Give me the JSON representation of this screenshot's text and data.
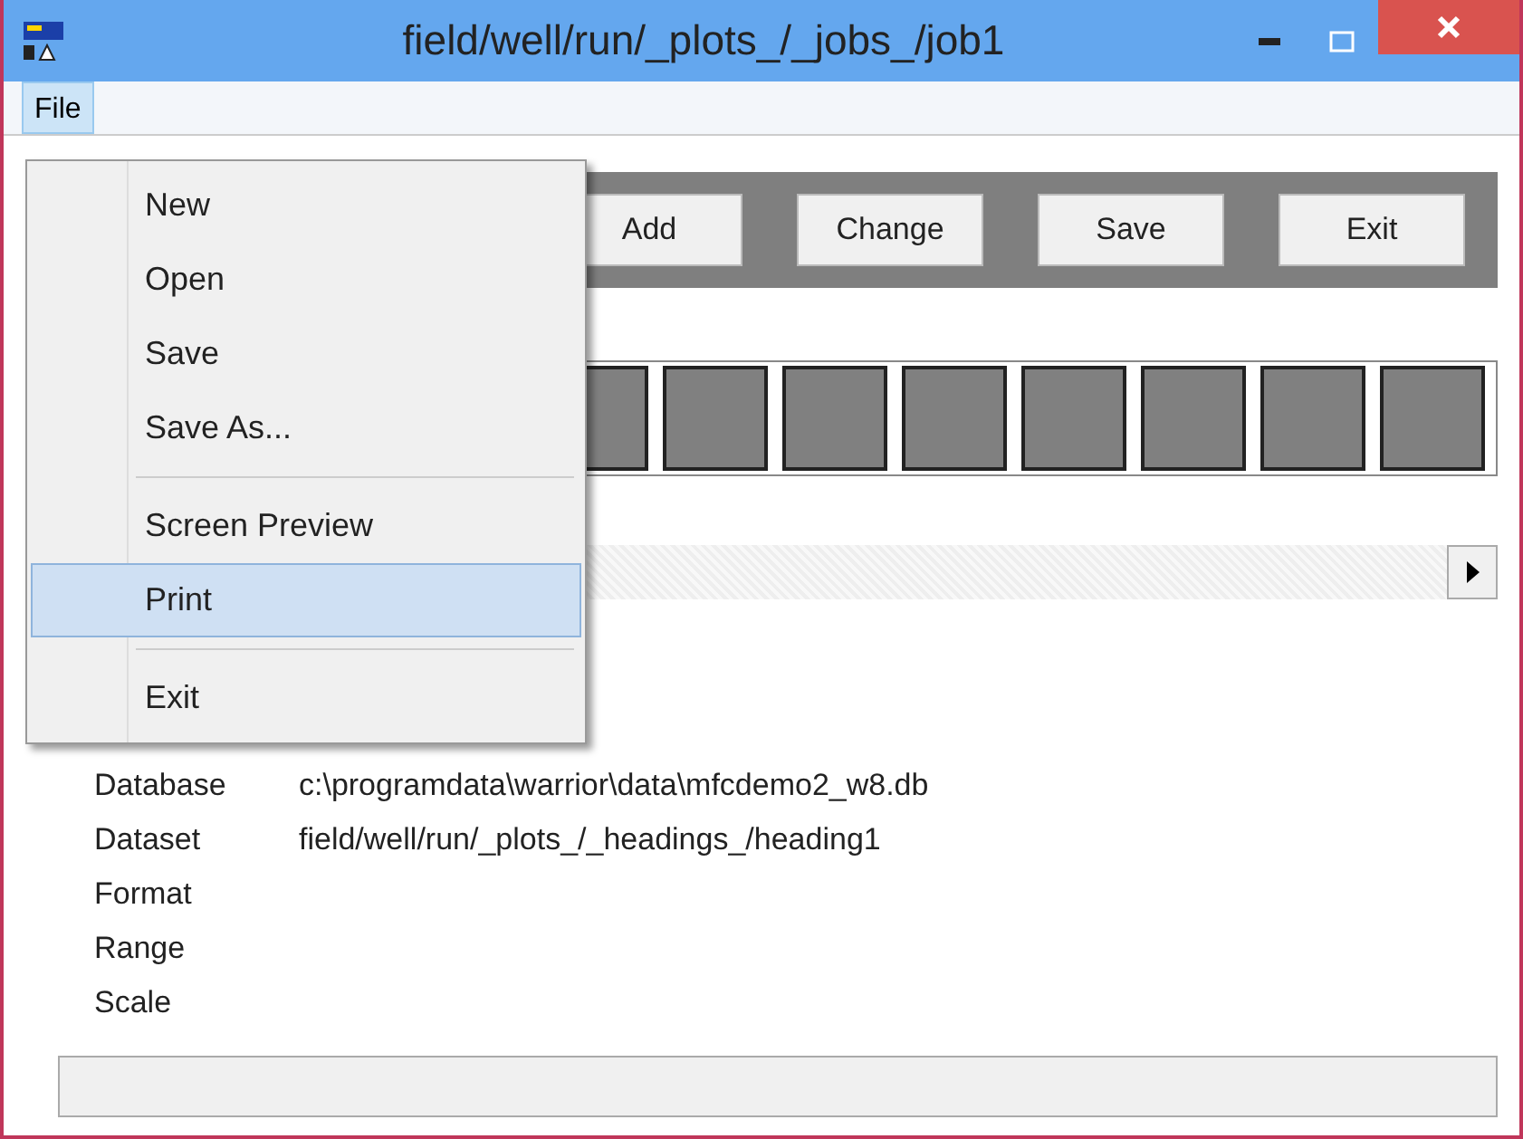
{
  "window": {
    "title": "field/well/run/_plots_/_jobs_/job1"
  },
  "menu_bar": [
    {
      "label": "File",
      "selected": true
    }
  ],
  "file_menu": [
    {
      "kind": "item",
      "label": "New",
      "selected": false
    },
    {
      "kind": "item",
      "label": "Open",
      "selected": false
    },
    {
      "kind": "item",
      "label": "Save",
      "selected": false
    },
    {
      "kind": "item",
      "label": "Save As...",
      "selected": false
    },
    {
      "kind": "separator"
    },
    {
      "kind": "item",
      "label": "Screen Preview",
      "selected": false
    },
    {
      "kind": "item",
      "label": "Print",
      "selected": true
    },
    {
      "kind": "separator"
    },
    {
      "kind": "item",
      "label": "Exit",
      "selected": false
    }
  ],
  "toolbar_buttons": [
    "Add",
    "Change",
    "Save",
    "Exit"
  ],
  "properties": [
    {
      "label": "Database",
      "value": "c:\\programdata\\warrior\\data\\mfcdemo2_w8.db"
    },
    {
      "label": "Dataset",
      "value": "field/well/run/_plots_/_headings_/heading1"
    },
    {
      "label": "Format"
    },
    {
      "label": "Range"
    },
    {
      "label": "Scale"
    }
  ]
}
